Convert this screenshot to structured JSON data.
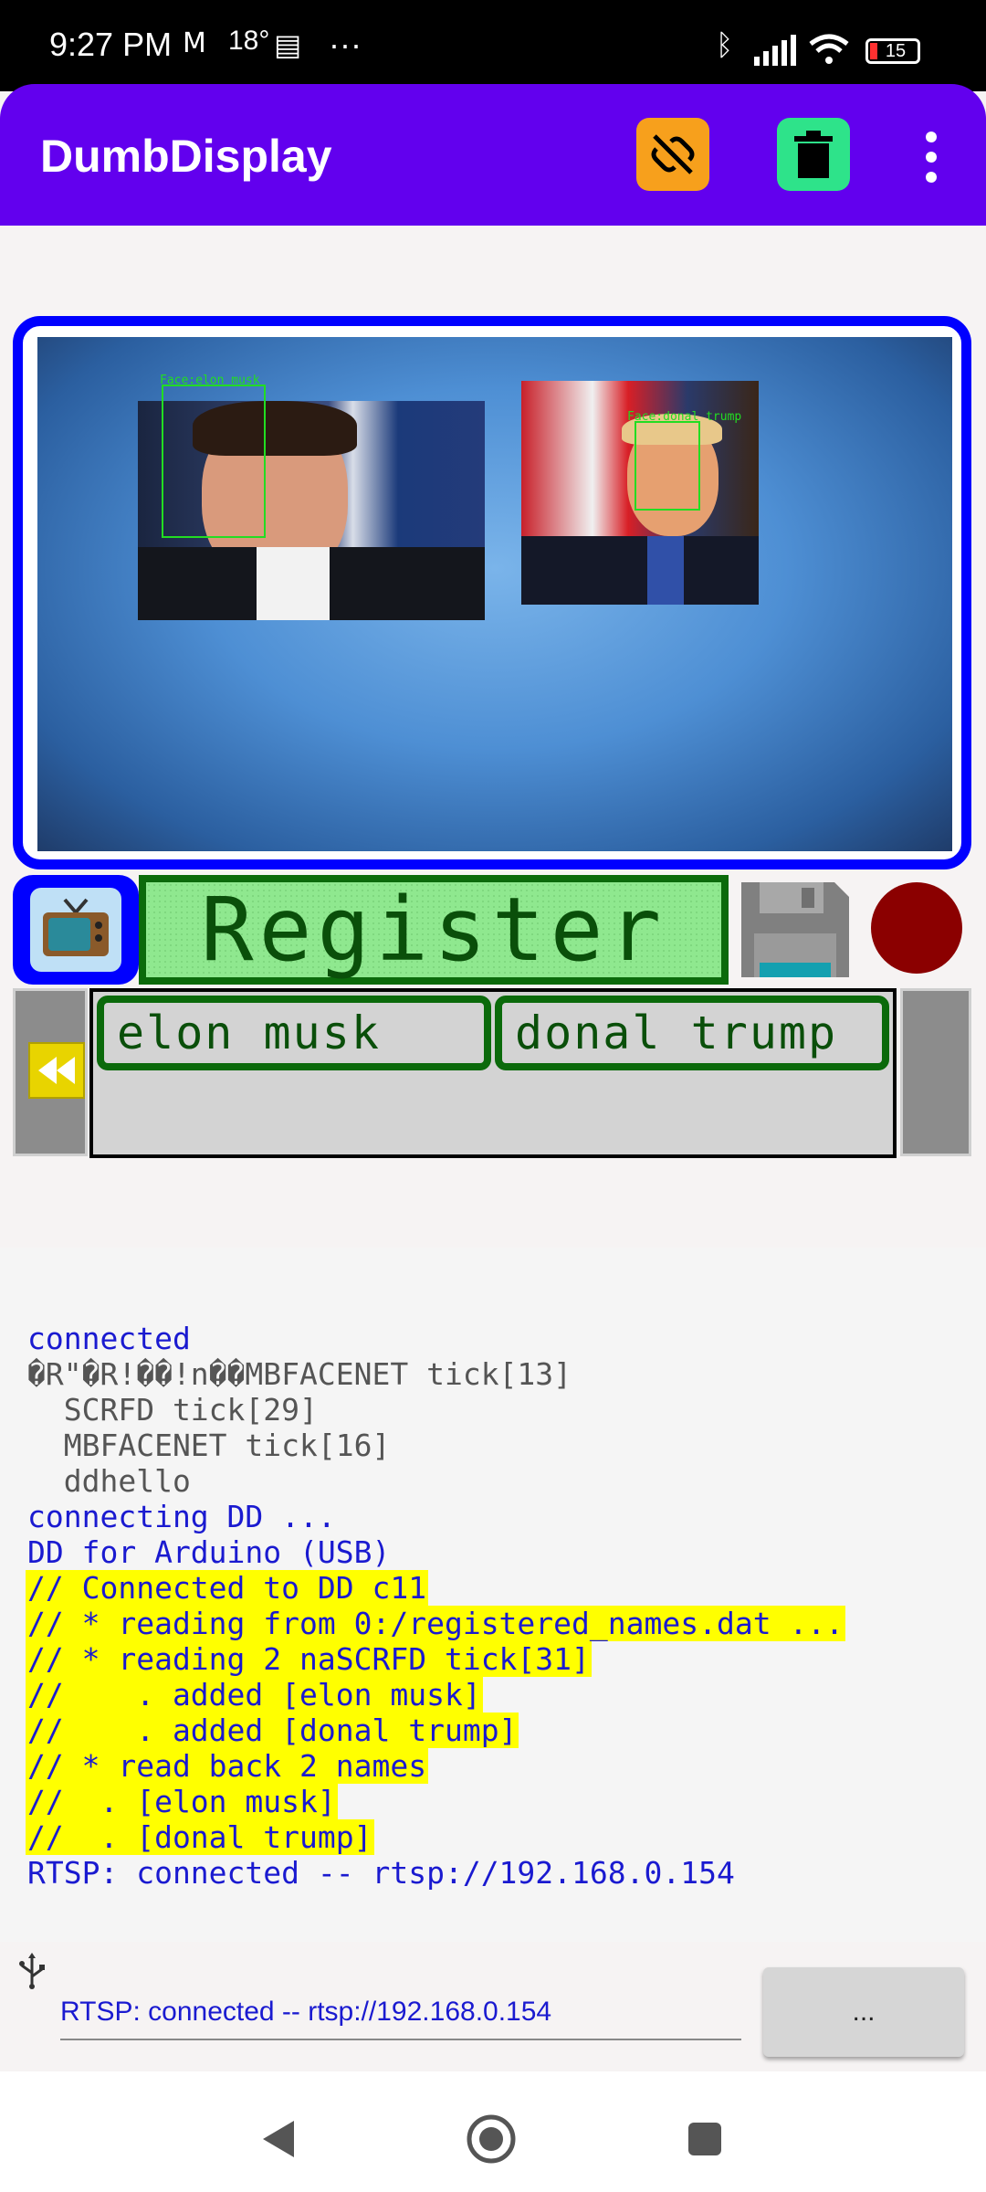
{
  "status_bar": {
    "time": "9:27 PM",
    "temperature": "18°",
    "overflow": "···",
    "battery": "15"
  },
  "app_bar": {
    "title": "DumbDisplay",
    "color": "#6200ee",
    "icons": [
      "unlink-icon",
      "trash-icon",
      "more-vert-icon"
    ]
  },
  "camera": {
    "faces": [
      {
        "label": "Face:elon musk"
      },
      {
        "label": "Face:donal trump"
      }
    ]
  },
  "controls": {
    "register_label": "Register",
    "record_color": "#8b0000"
  },
  "names": [
    "elon musk",
    "donal trump"
  ],
  "log": {
    "lines": [
      {
        "text": "connected",
        "style": "blue"
      },
      {
        "text": "�R\"�R!��!n��MBFACENET tick[13]",
        "style": "gray"
      },
      {
        "text": "  SCRFD tick[29]",
        "style": "gray"
      },
      {
        "text": "  MBFACENET tick[16]",
        "style": "gray"
      },
      {
        "text": "  ddhello",
        "style": "gray"
      },
      {
        "text": "connecting DD ...",
        "style": "blue"
      },
      {
        "text": "DD for Arduino (USB)",
        "style": "blue"
      },
      {
        "text": "// Connected to DD c11",
        "style": "highlight"
      },
      {
        "text": "// * reading from 0:/registered_names.dat ...",
        "style": "highlight"
      },
      {
        "text": "// * reading 2 naSCRFD tick[31]",
        "style": "highlight"
      },
      {
        "text": "//    . added [elon musk]",
        "style": "highlight"
      },
      {
        "text": "//    . added [donal trump]",
        "style": "highlight"
      },
      {
        "text": "// * read back 2 names",
        "style": "highlight"
      },
      {
        "text": "//  . [elon musk]",
        "style": "highlight"
      },
      {
        "text": "//  . [donal trump]",
        "style": "highlight"
      },
      {
        "text": "RTSP: connected -- rtsp://192.168.0.154",
        "style": "blue"
      }
    ]
  },
  "input": {
    "value": "RTSP: connected -- rtsp://192.168.0.154",
    "send_label": "..."
  }
}
